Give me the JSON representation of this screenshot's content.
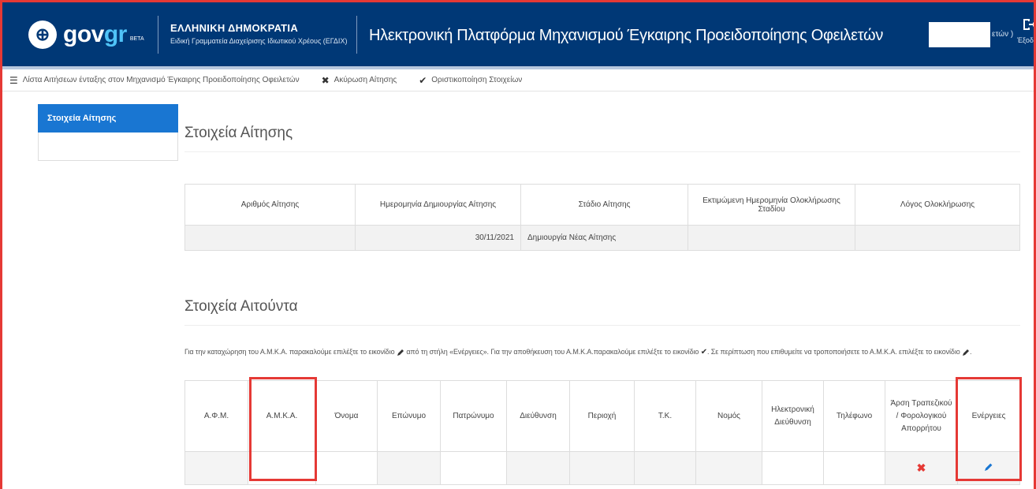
{
  "header": {
    "logo_main": "gov",
    "logo_accent": "gr",
    "logo_beta": "BETA",
    "ministry_title": "ΕΛΛΗΝΙΚΗ ΔΗΜΟΚΡΑΤΙΑ",
    "ministry_subtitle": "Ειδική Γραμματεία Διαχείρισης Ιδιωτικού Χρέους (ΕΓΔΙΧ)",
    "platform_title": "Ηλεκτρονική Πλατφόρμα Μηχανισμού Έγκαιρης Προειδοποίησης Οφειλετών",
    "user_suffix": "ετών )",
    "logout_label": "Έξοδ"
  },
  "toolbar": {
    "items": [
      {
        "label": "Λίστα Αιτήσεων ένταξης στον Μηχανισμό Έγκαιρης Προειδοποίησης Οφειλετών",
        "icon": "list-icon"
      },
      {
        "label": "Ακύρωση Αίτησης",
        "icon": "close-icon"
      },
      {
        "label": "Οριστικοποίηση Στοιχείων",
        "icon": "check-icon"
      }
    ]
  },
  "sidebar": {
    "items": [
      {
        "label": "Στοιχεία Αίτησης",
        "active": true
      }
    ]
  },
  "application": {
    "title": "Στοιχεία Αίτησης",
    "columns": [
      "Αριθμός Αίτησης",
      "Ημερομηνία Δημιουργίας Αίτησης",
      "Στάδιο Αίτησης",
      "Εκτιμώμενη Ημερομηνία Ολοκλήρωσης Σταδίου",
      "Λόγος Ολοκλήρωσης"
    ],
    "row": {
      "number": "",
      "date": "30/11/2021",
      "stage": "Δημιουργία Νέας Αίτησης",
      "estimated": "",
      "reason": ""
    }
  },
  "applicant": {
    "title": "Στοιχεία Αιτούντα",
    "instructions": {
      "part1": "Για την καταχώρηση του Α.Μ.Κ.Α. παρακαλούμε επιλέξτε το εικονίδιο",
      "part2": "από τη στήλη «Ενέργειες». Για την αποθήκευση του Α.Μ.Κ.Α.παρακαλούμε επιλέξτε το εικονίδιο",
      "part3": ". Σε περίπτωση που επιθυμείτε να τροποποιήσετε το Α.Μ.Κ.Α. επιλέξτε το εικονίδιο",
      "part4": "."
    },
    "columns": [
      "Α.Φ.Μ.",
      "Α.Μ.Κ.Α.",
      "Όνομα",
      "Επώνυμο",
      "Πατρώνυμο",
      "Διεύθυνση",
      "Περιοχή",
      "Τ.Κ.",
      "Νομός",
      "Ηλεκτρονική Διεύθυνση",
      "Τηλέφωνο",
      "Άρση Τραπεζικού / Φορολογικού Απορρήτου",
      "Ενέργειες"
    ],
    "row": [
      "",
      "",
      "",
      "",
      "",
      "",
      "",
      "",
      "",
      "",
      "",
      "",
      ""
    ]
  },
  "colors": {
    "header_bg": "#003876",
    "accent": "#1976d2",
    "highlight": "#e53935"
  }
}
